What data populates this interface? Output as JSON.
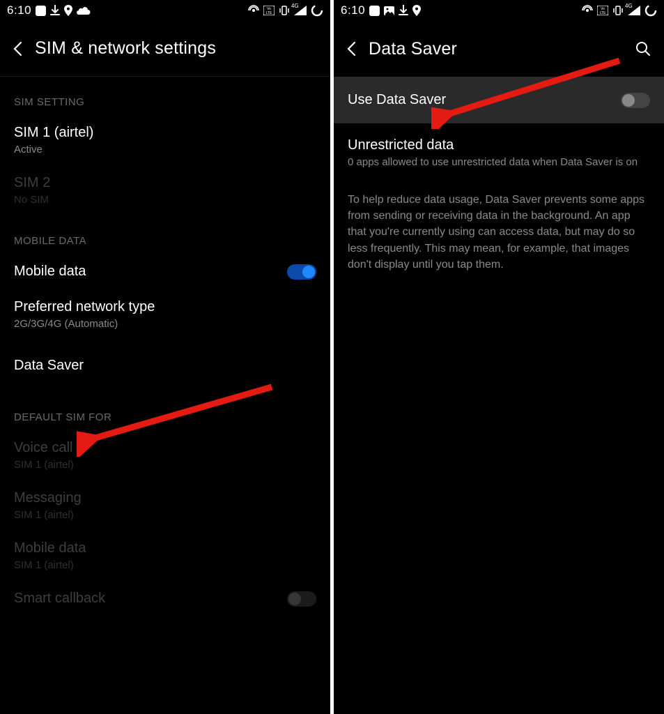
{
  "statusbar": {
    "time": "6:10",
    "signal_label": "4G"
  },
  "left": {
    "header_title": "SIM & network settings",
    "sections": {
      "sim_setting": {
        "label": "SIM SETTING",
        "sim1": {
          "title": "SIM 1  (airtel)",
          "sub": "Active"
        },
        "sim2": {
          "title": "SIM 2",
          "sub": "No SIM"
        }
      },
      "mobile_data": {
        "label": "MOBILE DATA",
        "mobile_data_row": "Mobile data",
        "pref_net": {
          "title": "Preferred network type",
          "sub": "2G/3G/4G (Automatic)"
        },
        "data_saver": "Data Saver"
      },
      "default_sim": {
        "label": "DEFAULT SIM FOR",
        "voice": {
          "title": "Voice call",
          "sub": "SIM 1  (airtel)"
        },
        "messaging": {
          "title": "Messaging",
          "sub": "SIM 1  (airtel)"
        },
        "mobile_data": {
          "title": "Mobile data",
          "sub": "SIM 1  (airtel)"
        },
        "smart_callback": "Smart callback"
      }
    }
  },
  "right": {
    "header_title": "Data Saver",
    "use_data_saver": "Use Data Saver",
    "unrestricted": {
      "title": "Unrestricted data",
      "sub": "0 apps allowed to use unrestricted data when Data Saver is on"
    },
    "info": "To help reduce data usage, Data Saver prevents some apps from sending or receiving data in the background. An app that you're currently using can access data, but may do so less frequently. This may mean, for example, that images don't display until you tap them."
  }
}
